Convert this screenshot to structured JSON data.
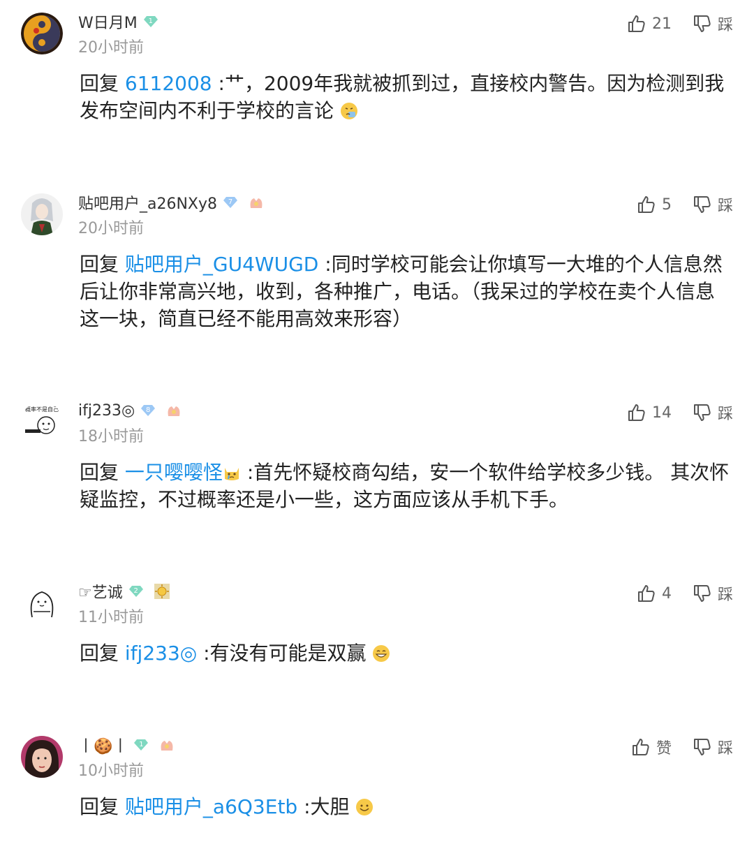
{
  "comments": [
    {
      "username": "W日月M",
      "level": "1",
      "time": "20小时前",
      "like_count": "21",
      "dislike_label": "踩",
      "reply_prefix": "回复",
      "reply_target": "6112008",
      "text": " :艹，2009年我就被抓到过，直接校内警告。因为检测到我发布空间内不利于学校的言论",
      "emoji": "sneezing-face"
    },
    {
      "username": "贴吧用户_a26NXy8",
      "level": "7",
      "time": "20小时前",
      "like_count": "5",
      "dislike_label": "踩",
      "reply_prefix": "回复",
      "reply_target": "贴吧用户_GU4WUGD",
      "text": " :同时学校可能会让你填写一大堆的个人信息然后让你非常高兴地，收到，各种推广，电话。（我呆过的学校在卖个人信息这一块，简直已经不能用高效来形容）"
    },
    {
      "username": "ifj233◎",
      "level": "8",
      "time": "18小时前",
      "like_count": "14",
      "dislike_label": "踩",
      "reply_prefix": "回复",
      "reply_target": "一只嘤嘤怪",
      "text": " :首先怀疑校商勾结，安一个软件给学校多少钱。 其次怀疑监控，不过概率还是小一些，这方面应该从手机下手。",
      "emoji": "crying-cat"
    },
    {
      "username": "☞艺诚",
      "level": "2",
      "time": "11小时前",
      "like_count": "4",
      "dislike_label": "踩",
      "reply_prefix": "回复",
      "reply_target": "ifj233◎",
      "text": " :有没有可能是双赢",
      "emoji": "grinning-face"
    },
    {
      "username": "丨🍪丨",
      "level": "1",
      "time": "10小时前",
      "like_count": "赞",
      "dislike_label": "踩",
      "reply_prefix": "回复",
      "reply_target": "贴吧用户_a6Q3Etb",
      "text": " :大胆",
      "emoji": "smiling-face"
    }
  ],
  "colors": {
    "link": "#1a8fe6",
    "time": "#999999",
    "text": "#222222",
    "badge_green": "#7fd8c0",
    "badge_blue": "#9cc8f5"
  }
}
